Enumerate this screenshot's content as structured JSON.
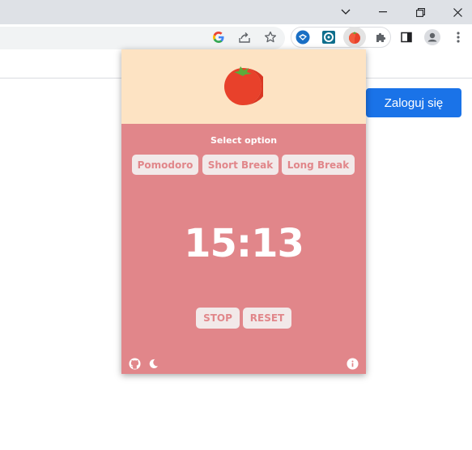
{
  "window": {
    "controls": {
      "minimize": "chevron-down-icon",
      "restore": "restore-icon",
      "close": "close-icon"
    }
  },
  "toolbar": {
    "icons": [
      "google-icon",
      "share-icon",
      "star-icon",
      "extension-blue-icon",
      "extension-target-icon",
      "tomato-extension-icon",
      "puzzle-icon",
      "side-panel-icon",
      "profile-icon",
      "menu-icon"
    ]
  },
  "page": {
    "login_label": "Zaloguj się"
  },
  "popup": {
    "select_title": "Select option",
    "options": [
      {
        "label": "Pomodoro"
      },
      {
        "label": "Short Break"
      },
      {
        "label": "Long Break"
      }
    ],
    "timer": "15:13",
    "controls": {
      "stop": "STOP",
      "reset": "RESET"
    },
    "footer_icons": [
      "github-icon",
      "moon-icon",
      "info-icon"
    ],
    "colors": {
      "header_bg": "#fde3c3",
      "body_bg": "#e1868a",
      "button_bg": "#f2e9e9",
      "button_text": "#e1868a",
      "tomato": "#e8412b"
    }
  }
}
